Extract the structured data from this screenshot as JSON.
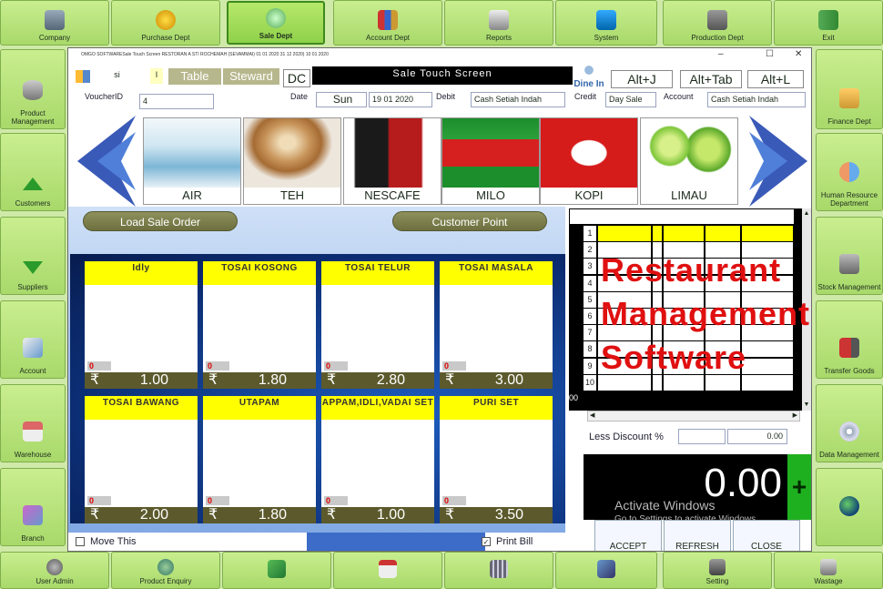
{
  "top_nav": [
    {
      "label": "Company",
      "icon": "company-icon"
    },
    {
      "label": "Purchase Dept",
      "icon": "purchase-icon"
    },
    {
      "label": "Sale Dept",
      "icon": "sale-icon",
      "active": true
    },
    {
      "label": "Account Dept",
      "icon": "books-icon"
    },
    {
      "label": "Reports",
      "icon": "reports-icon"
    },
    {
      "label": "System",
      "icon": "system-icon"
    },
    {
      "label": "Production Dept",
      "icon": "factory-icon"
    },
    {
      "label": "Exit",
      "icon": "exit-icon"
    }
  ],
  "left_nav": [
    {
      "label": "Product Management",
      "icon": "database-icon"
    },
    {
      "label": "Customers",
      "icon": "arrow-up-icon"
    },
    {
      "label": "Suppliers",
      "icon": "arrow-down-icon"
    },
    {
      "label": "Account",
      "icon": "account-icon"
    },
    {
      "label": "Warehouse",
      "icon": "house-icon"
    },
    {
      "label": "Branch",
      "icon": "branch-icon"
    }
  ],
  "right_nav": [
    {
      "label": "Finance Dept",
      "icon": "finance-icon"
    },
    {
      "label": "Human Resource Department",
      "icon": "people-icon"
    },
    {
      "label": "Stock Management",
      "icon": "stock-icon"
    },
    {
      "label": "Transfer Goods",
      "icon": "truck-icon"
    },
    {
      "label": "Data Management",
      "icon": "disc-icon"
    },
    {
      "label": "",
      "icon": "globe-icon"
    }
  ],
  "bottom_nav": [
    {
      "label": "User Admin",
      "icon": "users-icon"
    },
    {
      "label": "Product Enquiry",
      "icon": "enquiry-icon"
    },
    {
      "label": "",
      "icon": "notepad-icon"
    },
    {
      "label": "",
      "icon": "calendar-icon"
    },
    {
      "label": "",
      "icon": "grid-icon"
    },
    {
      "label": "",
      "icon": "network-icon"
    },
    {
      "label": "Setting",
      "icon": "settings-icon"
    },
    {
      "label": "Wastage",
      "icon": "wastage-icon"
    }
  ],
  "window": {
    "title": "OMGO SOFTWARESale Touch Screen   RESTORAN A STI ROCHEMAH (SEVAMMAI) 01 01 2020 31 12 2020) 10 01 2020",
    "user_value": "si",
    "user_marker": "I",
    "table_label": "Table",
    "steward_label": "Steward",
    "dc_label": "DC",
    "screen_title": "Sale Touch Screen",
    "hotkeys": [
      "Alt+J",
      "Alt+Tab",
      "Alt+L"
    ],
    "logo_text": "Dine In",
    "voucher_label": "VoucherID",
    "voucher_value": "4",
    "date_label": "Date",
    "day_value": "Sun",
    "date_value": "19 01 2020",
    "debit_label": "Debit",
    "debit_value": "Cash Setiah Indah",
    "credit_label": "Credit",
    "credit_value": "Day Sale",
    "account_label": "Account",
    "account_value": "Cash Setiah Indah"
  },
  "products": [
    "AIR",
    "TEH",
    "NESCAFE",
    "MILO",
    "KOPI",
    "LIMAU"
  ],
  "actions": {
    "load_sale_order": "Load Sale Order",
    "customer_point": "Customer Point"
  },
  "menu_items": [
    {
      "name": "Idly",
      "qty": "0",
      "currency": "₹",
      "price": "1.00"
    },
    {
      "name": "TOSAI KOSONG",
      "qty": "0",
      "currency": "₹",
      "price": "1.80"
    },
    {
      "name": "TOSAI TELUR",
      "qty": "0",
      "currency": "₹",
      "price": "2.80"
    },
    {
      "name": "TOSAI MASALA",
      "qty": "0",
      "currency": "₹",
      "price": "3.00"
    },
    {
      "name": "TOSAI BAWANG",
      "qty": "0",
      "currency": "₹",
      "price": "2.00"
    },
    {
      "name": "UTAPAM",
      "qty": "0",
      "currency": "₹",
      "price": "1.80"
    },
    {
      "name": "APPAM,IDLI,VADAI SET",
      "qty": "0",
      "currency": "₹",
      "price": "1.00"
    },
    {
      "name": "PURI SET",
      "qty": "0",
      "currency": "₹",
      "price": "3.50"
    }
  ],
  "bottom": {
    "move_this": "Move This",
    "print_bill": "Print Bill",
    "print_bill_checked": "✓"
  },
  "grid_rows": [
    "1",
    "2",
    "3",
    "4",
    "5",
    "6",
    "7",
    "8",
    "9",
    "10"
  ],
  "grid_footer_text": "00",
  "overlay_text": [
    "Restaurant",
    "Management",
    "Software"
  ],
  "discount": {
    "label": "Less Discount %",
    "value": "0.00"
  },
  "total": "0.00",
  "plus_label": "+",
  "watermark": {
    "line1": "Activate Windows",
    "line2": "Go to Settings to activate Windows."
  },
  "buttons": {
    "accept": "ACCEPT",
    "refresh": "REFRESH",
    "close": "CLOSE"
  },
  "colors": {
    "shell_green": "#a8d96a",
    "tile_header_yellow": "#ffff00",
    "price_bar": "#5c5a2c",
    "overlay_red": "#e01010",
    "plus_green": "#1fb01f"
  }
}
